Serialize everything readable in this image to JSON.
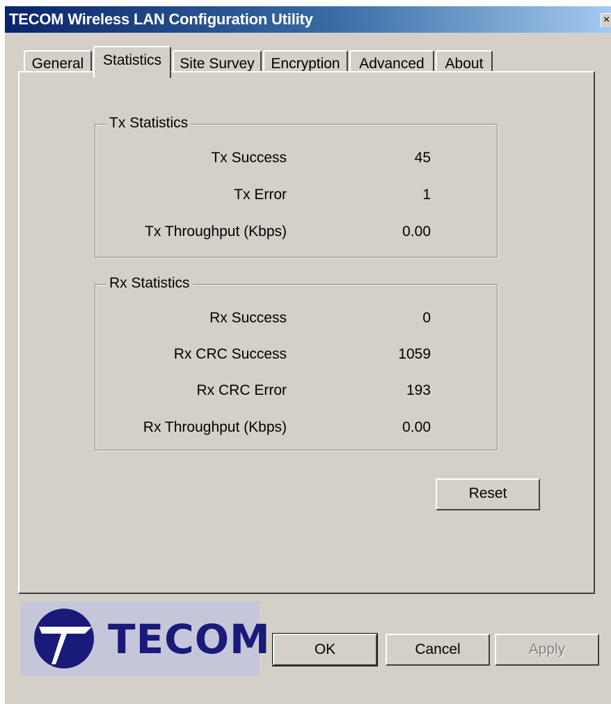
{
  "window": {
    "title": "TECOM Wireless LAN Configuration Utility",
    "close_glyph": "×"
  },
  "tabs": [
    {
      "label": "General",
      "active": false
    },
    {
      "label": "Statistics",
      "active": true
    },
    {
      "label": "Site Survey",
      "active": false
    },
    {
      "label": "Encryption",
      "active": false
    },
    {
      "label": "Advanced",
      "active": false
    },
    {
      "label": "About",
      "active": false
    }
  ],
  "tx": {
    "title": "Tx Statistics",
    "rows": [
      {
        "label": "Tx Success",
        "value": "45"
      },
      {
        "label": "Tx Error",
        "value": "1"
      },
      {
        "label": "Tx Throughput (Kbps)",
        "value": "0.00"
      }
    ]
  },
  "rx": {
    "title": "Rx Statistics",
    "rows": [
      {
        "label": "Rx Success",
        "value": "0"
      },
      {
        "label": "Rx CRC Success",
        "value": "1059"
      },
      {
        "label": "Rx CRC Error",
        "value": "193"
      },
      {
        "label": "Rx Throughput (Kbps)",
        "value": "0.00"
      }
    ]
  },
  "buttons": {
    "reset": "Reset",
    "ok": "OK",
    "cancel": "Cancel",
    "apply": "Apply"
  },
  "logo": {
    "text": "TECOM",
    "colors": {
      "background": "#c6c6da",
      "mark": "#1a1a7a"
    }
  }
}
